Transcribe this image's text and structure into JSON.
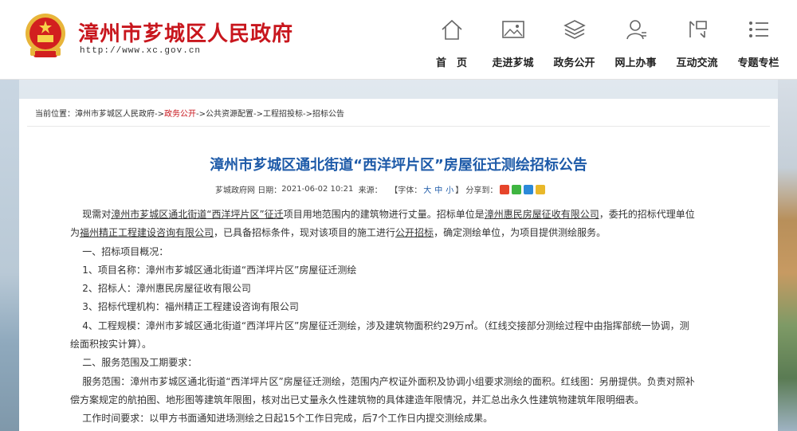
{
  "header": {
    "site_title": "漳州市芗城区人民政府",
    "site_url": "http://www.xc.gov.cn",
    "emblem_icon": "national-emblem-icon",
    "nav": [
      {
        "label": "首　页",
        "icon": "home-icon"
      },
      {
        "label": "走进芗城",
        "icon": "picture-icon"
      },
      {
        "label": "政务公开",
        "icon": "layers-icon"
      },
      {
        "label": "网上办事",
        "icon": "user-icon"
      },
      {
        "label": "互动交流",
        "icon": "exchange-icon"
      },
      {
        "label": "专题专栏",
        "icon": "list-icon"
      }
    ]
  },
  "breadcrumb": {
    "prefix": "当前位置：",
    "items": [
      "漳州市芗城区人民政府",
      "政务公开",
      "公共资源配置",
      "工程招投标",
      "招标公告"
    ],
    "separator": "->",
    "active_index": 1
  },
  "article": {
    "title": "漳州市芗城区通北街道“西洋坪片区”房屋征迁测绘招标公告",
    "meta": {
      "source": "芗城政府网",
      "date_label": "日期：",
      "date": "2021-06-02 10:21",
      "origin_label": "来源：",
      "font_label": "【字体：",
      "font_large": "大",
      "font_medium": "中",
      "font_small": "小",
      "font_close": "】",
      "share_label": "分享到：",
      "share_icons": [
        "weibo-icon",
        "wechat-icon",
        "qq-icon",
        "qzone-icon"
      ]
    },
    "para1_a": "现需对",
    "para1_b": "漳州市芗城区通北街道",
    "para1_c": "“西洋坪片区”",
    "para1_d": "征迁",
    "para1_e": "项目用地范围内的建筑物进行丈量。招标单位是",
    "para1_f": "漳州惠民房屋征收有限公司",
    "para1_g": "，委托的招标代理单位",
    "para1_h": "为",
    "para1_i": "福州精正工程建设咨询有限公司",
    "para1_j": "，已具备招标条件，现对该项目的施工进行",
    "para1_k": "公开招标",
    "para1_l": "，确定测绘单位，为项目提供测绘服务。",
    "s1_title": "一、招标项目概况：",
    "item1": "1、项目名称：漳州市芗城区通北街道“西洋坪片区”房屋征迁测绘",
    "item2": "2、招标人：漳州惠民房屋征收有限公司",
    "item3": "3、招标代理机构：福州精正工程建设咨询有限公司",
    "item4_a": "4、工程规模：漳州市芗城区通北街道“西洋坪片区”房屋征迁测绘，涉及建筑物面积约29万㎡。（红线交接部分测绘过程中由指挥部统一协调，测",
    "item4_b": "绘面积按实计算）。",
    "s2_title": "二、服务范围及工期要求：",
    "scope_a": "服务范围：漳州市芗城区通北街道“西洋坪片区”房屋征迁测绘，范围内产权证外面积及协调小组要求测绘的面积。红线图：另册提供。负责对照补",
    "scope_b": "偿方案规定的航拍图、地形图等建筑年限图，核对出已丈量永久性建筑物的具体建造年限情况，并汇总出永久性建筑物建筑年限明细表。",
    "worktime": "工作时间要求：以甲方书面通知进场测绘之日起15个工作日完成，后7个工作日内提交测绘成果。"
  },
  "colors": {
    "brand_red": "#c8161d",
    "link_blue": "#1d5aa8"
  }
}
